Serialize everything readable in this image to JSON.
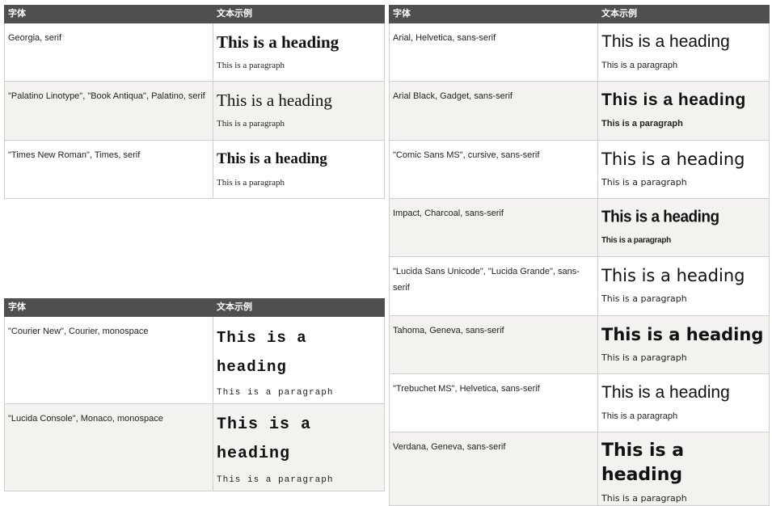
{
  "headers": {
    "font": "字体",
    "sample": "文本示例"
  },
  "sample_heading": "This is a heading",
  "sample_paragraph": "This is a paragraph",
  "serif_table": {
    "rows": [
      {
        "name": "Georgia, serif"
      },
      {
        "name": "\"Palatino Linotype\", \"Book Antiqua\", Palatino, serif"
      },
      {
        "name": "\"Times New Roman\", Times, serif"
      }
    ]
  },
  "mono_table": {
    "rows": [
      {
        "name": "\"Courier New\", Courier, monospace"
      },
      {
        "name": "\"Lucida Console\", Monaco, monospace"
      }
    ]
  },
  "sans_table": {
    "rows": [
      {
        "name": "Arial, Helvetica, sans-serif"
      },
      {
        "name": "Arial Black, Gadget, sans-serif"
      },
      {
        "name": "\"Comic Sans MS\", cursive, sans-serif"
      },
      {
        "name": "Impact, Charcoal, sans-serif"
      },
      {
        "name_line1": "\"Lucida Sans Unicode\", \"Lucida Grande\", sans-",
        "name_line2": "serif"
      },
      {
        "name": "Tahoma, Geneva, sans-serif"
      },
      {
        "name": "\"Trebuchet MS\", Helvetica, sans-serif"
      },
      {
        "name": "Verdana, Geneva, sans-serif"
      }
    ]
  },
  "colors": {
    "header_bg": "#4f4f4f",
    "alt_row_bg": "#f3f2ef",
    "border": "#cfcfcf"
  }
}
